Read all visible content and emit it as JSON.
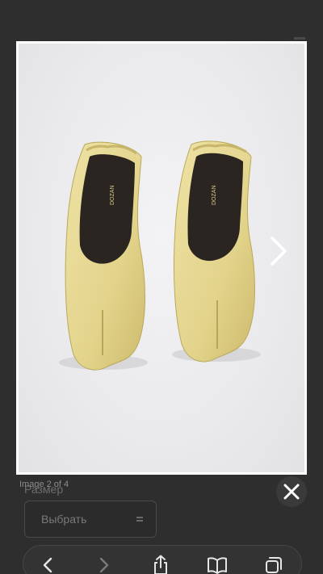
{
  "lightbox": {
    "counter": "Image 2 of 4",
    "image_alt": "Yellow leather tabi ballet flats",
    "shoe_brand_mark": "DOZAN"
  },
  "page": {
    "size_label": "Размер",
    "size_select_value": "Выбрать"
  },
  "icons": {
    "next": "chevron-right-icon",
    "close": "close-icon",
    "back": "chevron-left-icon",
    "forward": "chevron-right-icon",
    "share": "share-icon",
    "bookmarks": "book-icon",
    "tabs": "tabs-icon"
  },
  "colors": {
    "shoe": "#e6d894",
    "shoe_shadow": "#c9b86a",
    "shoe_interior": "#2a2522",
    "backdrop": "#2f2f2f"
  }
}
